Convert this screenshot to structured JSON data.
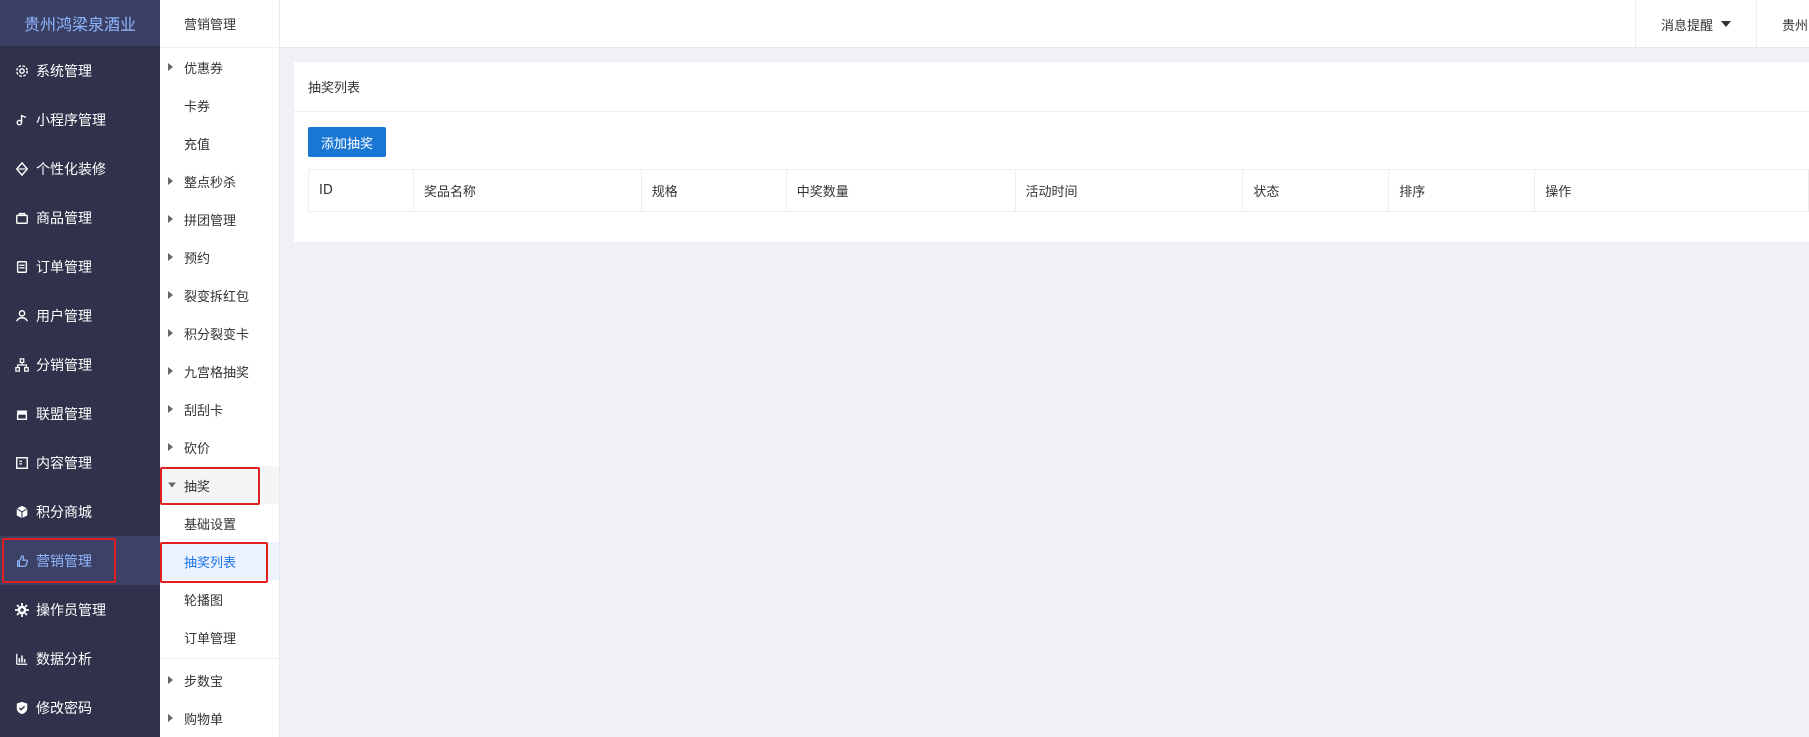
{
  "brand": "贵州鸿梁泉酒业",
  "main_nav": [
    {
      "label": "系统管理",
      "icon": "gear-icon"
    },
    {
      "label": "小程序管理",
      "icon": "music-note-icon"
    },
    {
      "label": "个性化装修",
      "icon": "diamond-icon"
    },
    {
      "label": "商品管理",
      "icon": "bag-icon"
    },
    {
      "label": "订单管理",
      "icon": "order-icon"
    },
    {
      "label": "用户管理",
      "icon": "user-icon"
    },
    {
      "label": "分销管理",
      "icon": "hierarchy-icon"
    },
    {
      "label": "联盟管理",
      "icon": "store-icon"
    },
    {
      "label": "内容管理",
      "icon": "content-icon"
    },
    {
      "label": "积分商城",
      "icon": "cube-icon"
    },
    {
      "label": "营销管理",
      "icon": "hand-icon"
    },
    {
      "label": "操作员管理",
      "icon": "cog-icon"
    },
    {
      "label": "数据分析",
      "icon": "bar-chart-icon"
    },
    {
      "label": "修改密码",
      "icon": "shield-icon"
    }
  ],
  "sub_nav": {
    "title": "营销管理",
    "items": [
      {
        "label": "优惠券",
        "type": "group"
      },
      {
        "label": "卡券",
        "type": "leaf"
      },
      {
        "label": "充值",
        "type": "leaf"
      },
      {
        "label": "整点秒杀",
        "type": "group"
      },
      {
        "label": "拼团管理",
        "type": "group"
      },
      {
        "label": "预约",
        "type": "group"
      },
      {
        "label": "裂变拆红包",
        "type": "group"
      },
      {
        "label": "积分裂变卡",
        "type": "group"
      },
      {
        "label": "九宫格抽奖",
        "type": "group"
      },
      {
        "label": "刮刮卡",
        "type": "group"
      },
      {
        "label": "砍价",
        "type": "group"
      },
      {
        "label": "抽奖",
        "type": "open"
      },
      {
        "label": "基础设置",
        "type": "leaf"
      },
      {
        "label": "抽奖列表",
        "type": "selected"
      },
      {
        "label": "轮播图",
        "type": "leaf"
      },
      {
        "label": "订单管理",
        "type": "leaf"
      },
      {
        "label": "步数宝",
        "type": "group"
      },
      {
        "label": "购物单",
        "type": "group"
      }
    ]
  },
  "topbar": {
    "notify": "消息提醒",
    "user": "贵州"
  },
  "content": {
    "title": "抽奖列表",
    "add_button": "添加抽奖",
    "columns": [
      "ID",
      "奖品名称",
      "规格",
      "中奖数量",
      "活动时间",
      "状态",
      "排序",
      "操作"
    ]
  },
  "colors": {
    "sidebar_bg": "#30324b",
    "accent": "#1976d2",
    "highlight_border": "#e02020"
  }
}
